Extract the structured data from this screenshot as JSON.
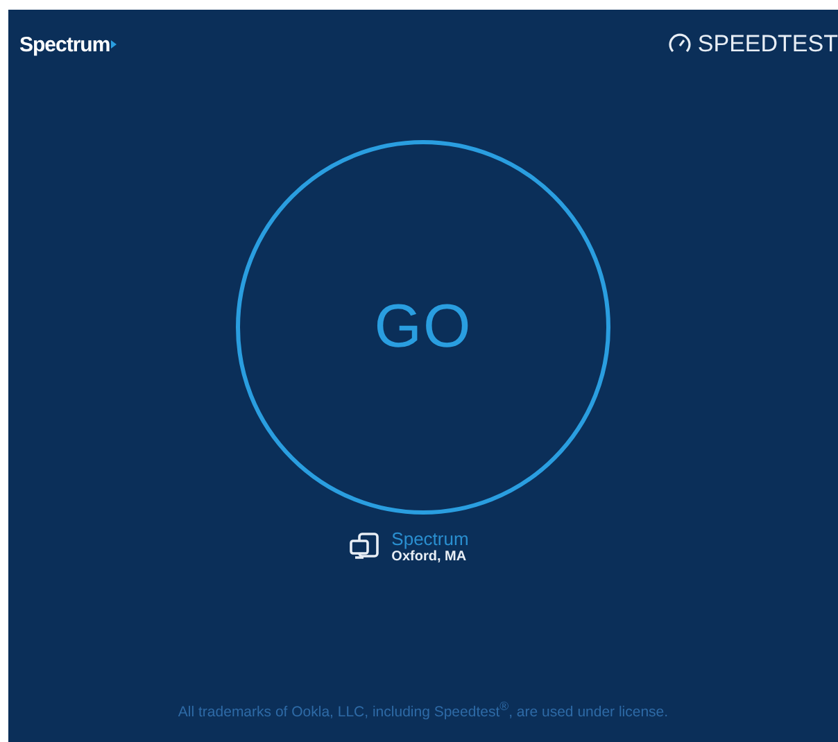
{
  "header": {
    "brand": "Spectrum",
    "product": "SPEEDTEST"
  },
  "go_button": {
    "label": "GO"
  },
  "server": {
    "provider": "Spectrum",
    "location": "Oxford, MA"
  },
  "footer": {
    "notice": "All trademarks of Ookla, LLC, including Speedtest$^{®}$, are used under license."
  }
}
